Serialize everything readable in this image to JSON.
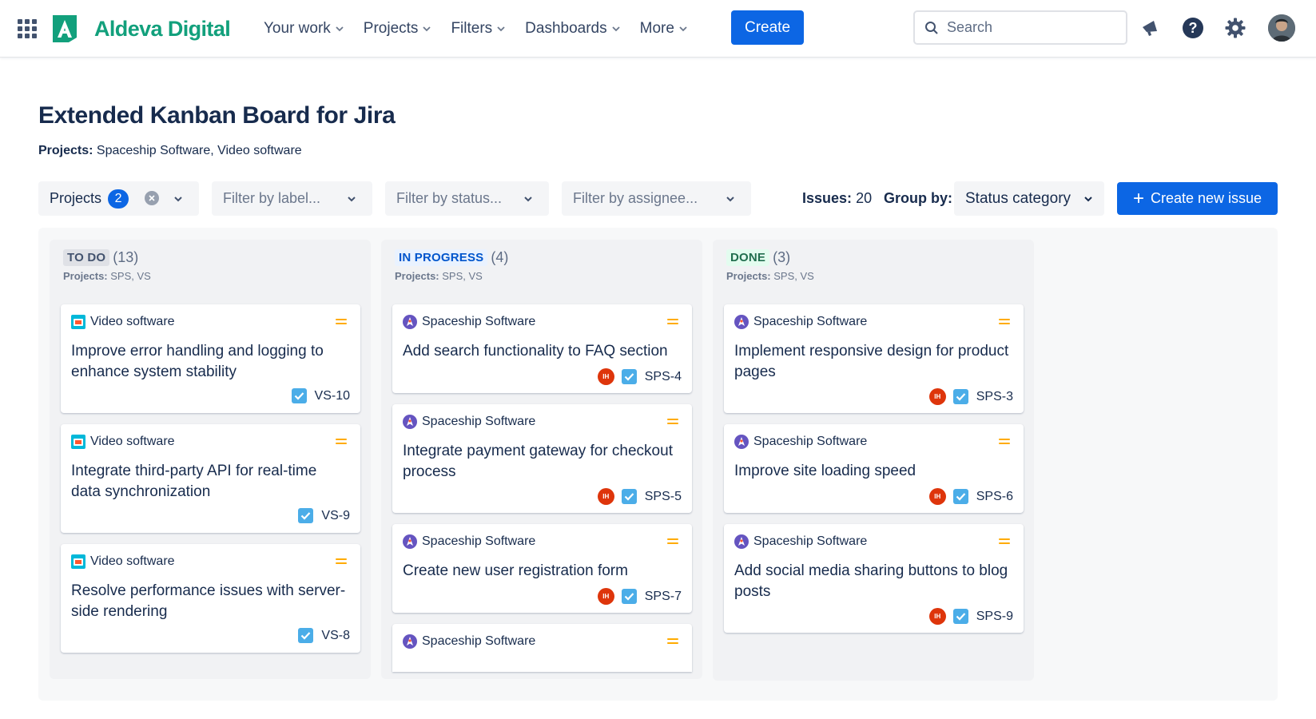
{
  "nav": {
    "brand": "Aldeva Digital",
    "items": [
      {
        "label": "Your work"
      },
      {
        "label": "Projects"
      },
      {
        "label": "Filters"
      },
      {
        "label": "Dashboards"
      },
      {
        "label": "More"
      }
    ],
    "create_label": "Create",
    "search_placeholder": "Search"
  },
  "page": {
    "title": "Extended Kanban Board for Jira",
    "projects_label": "Projects:",
    "projects_value": "Spaceship Software, Video software"
  },
  "filters": {
    "projects_label": "Projects",
    "projects_count": "2",
    "label_placeholder": "Filter by label...",
    "status_placeholder": "Filter by status...",
    "assignee_placeholder": "Filter by assignee...",
    "issues_label": "Issues:",
    "issues_count": "20",
    "group_by_label": "Group by:",
    "group_by_value": "Status category",
    "create_issue_label": "Create new issue"
  },
  "columns": [
    {
      "status": "TO DO",
      "count": "(13)",
      "projects_label": "Projects:",
      "projects_value": "SPS, VS",
      "cards": [
        {
          "project": "Video software",
          "title": "Improve error handling and logging to enhance system stability",
          "key": "VS-10",
          "assignee": ""
        },
        {
          "project": "Video software",
          "title": "Integrate third-party API for real-time data synchronization",
          "key": "VS-9",
          "assignee": ""
        },
        {
          "project": "Video software",
          "title": "Resolve performance issues with server-side rendering",
          "key": "VS-8",
          "assignee": ""
        }
      ]
    },
    {
      "status": "IN PROGRESS",
      "count": "(4)",
      "projects_label": "Projects:",
      "projects_value": "SPS, VS",
      "cards": [
        {
          "project": "Spaceship Software",
          "title": "Add search functionality to FAQ section",
          "key": "SPS-4",
          "assignee": "IH"
        },
        {
          "project": "Spaceship Software",
          "title": "Integrate payment gateway for checkout process",
          "key": "SPS-5",
          "assignee": "IH"
        },
        {
          "project": "Spaceship Software",
          "title": "Create new user registration form",
          "key": "SPS-7",
          "assignee": "IH"
        },
        {
          "project": "Spaceship Software",
          "title": "",
          "key": "",
          "assignee": ""
        }
      ]
    },
    {
      "status": "DONE",
      "count": "(3)",
      "projects_label": "Projects:",
      "projects_value": "SPS, VS",
      "cards": [
        {
          "project": "Spaceship Software",
          "title": "Implement responsive design for product pages",
          "key": "SPS-3",
          "assignee": "IH"
        },
        {
          "project": "Spaceship Software",
          "title": "Improve site loading speed",
          "key": "SPS-6",
          "assignee": "IH"
        },
        {
          "project": "Spaceship Software",
          "title": "Add social media sharing buttons to blog posts",
          "key": "SPS-9",
          "assignee": "IH"
        }
      ]
    }
  ],
  "icons": {
    "apps": "apps-grid-icon",
    "notifications": "megaphone-icon",
    "help": "help-icon",
    "settings": "gear-icon",
    "priority": "priority-medium-icon",
    "issue_type": "task-checkbox-icon"
  },
  "colors": {
    "brand": "#12a07c",
    "primary": "#0c66e4",
    "priority_medium": "#ffab00",
    "task": "#4bade8",
    "assignee": "#de350b"
  }
}
